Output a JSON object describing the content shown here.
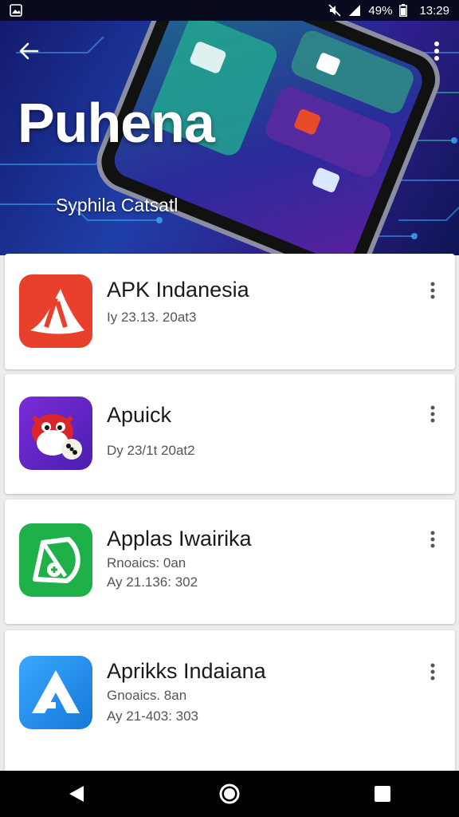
{
  "status_bar": {
    "battery_percent": "49%",
    "time": "13:29",
    "icons": [
      "image-icon",
      "mute-icon",
      "signal-icon",
      "battery-icon"
    ]
  },
  "header": {
    "title": "Puhena",
    "subtitle": "Syphila Catsatl",
    "back_icon": "arrow-left-icon",
    "menu_icon": "more-vert-icon"
  },
  "apps": [
    {
      "name": "APK Indanesia",
      "meta_lines": [
        "Iy 23.13. 20at3"
      ],
      "icon": "red-lambda-icon",
      "accent": "#e8402a"
    },
    {
      "name": "Apuick",
      "meta_lines": [
        "Dy 23/1t 20at2"
      ],
      "icon": "red-monster-icon",
      "accent": "#6a2bd8"
    },
    {
      "name": "Applas Iwairika",
      "meta_lines": [
        "Rnoaics: 0an",
        "Ay 21.136: 302"
      ],
      "icon": "green-leaf-icon",
      "accent": "#1fb04a"
    },
    {
      "name": "Aprikks Indaiana",
      "meta_lines": [
        "Gnoaics. 8an",
        "Ay 21-403: 303"
      ],
      "icon": "blue-a-icon",
      "accent": "#1e8fe6"
    }
  ],
  "nav_bar": {
    "icons": [
      "back-triangle-icon",
      "home-circle-icon",
      "recents-square-icon"
    ]
  }
}
